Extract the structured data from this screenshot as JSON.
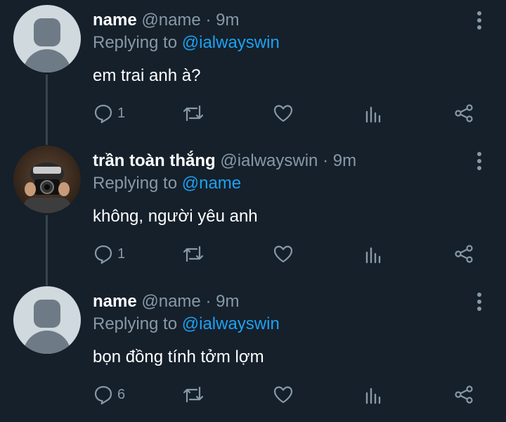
{
  "tweets": [
    {
      "display_name": "name",
      "handle": "@name",
      "time": "· 9m",
      "replying_label": "Replying to",
      "replying_to": "@ialwayswin",
      "text": "em trai anh à?",
      "reply_count": "1",
      "avatar": "default-avatar-icon"
    },
    {
      "display_name": "trần toàn thắng",
      "handle": "@ialwayswin",
      "time": "· 9m",
      "replying_label": "Replying to",
      "replying_to": "@name",
      "text": "không, người yêu anh",
      "reply_count": "1",
      "avatar": "photo-avatar"
    },
    {
      "display_name": "name",
      "handle": "@name",
      "time": "· 9m",
      "replying_label": "Replying to",
      "replying_to": "@ialwayswin",
      "text": "bọn đồng tính tởm lợm",
      "reply_count": "6",
      "avatar": "default-avatar-icon"
    }
  ],
  "colors": {
    "background": "#15202b",
    "text": "#ffffff",
    "muted": "#8899a6",
    "accent": "#1da1f2",
    "thread_line": "#38444d"
  },
  "icons": [
    "reply-icon",
    "retweet-icon",
    "like-icon",
    "analytics-icon",
    "share-icon",
    "more-options-icon"
  ]
}
